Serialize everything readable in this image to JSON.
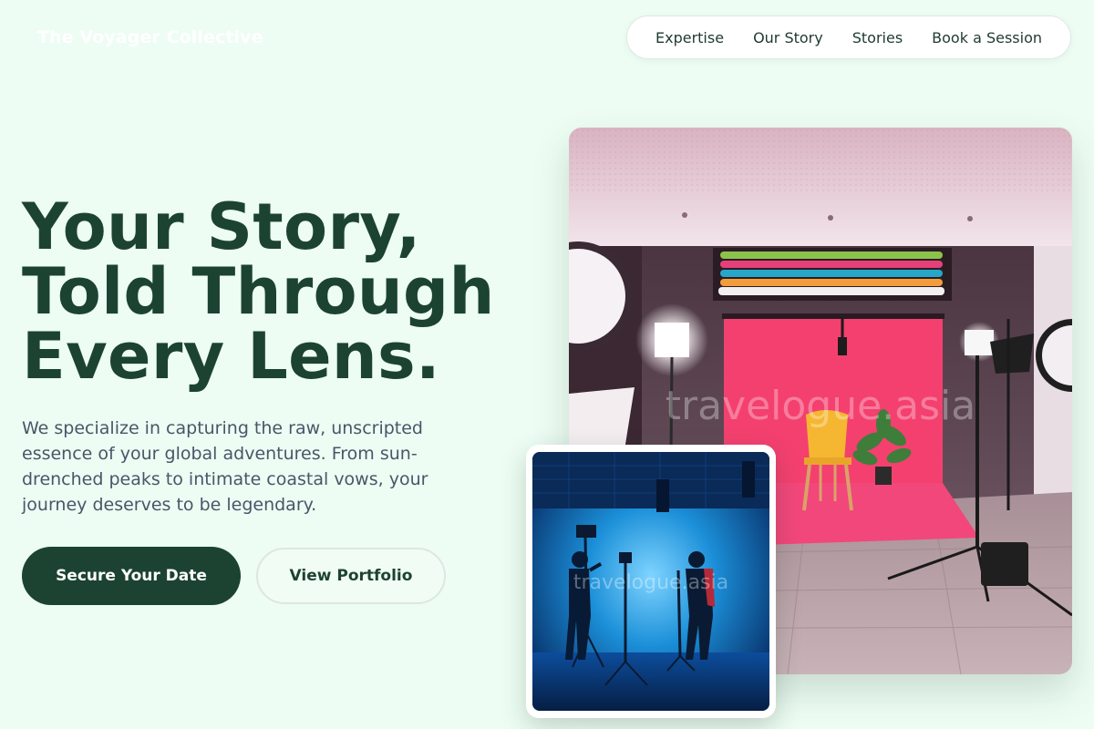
{
  "header": {
    "brand": "The Voyager Collective",
    "nav": [
      {
        "label": "Expertise"
      },
      {
        "label": "Our Story"
      },
      {
        "label": "Stories"
      },
      {
        "label": "Book a Session"
      }
    ]
  },
  "hero": {
    "title_lines": [
      "Your Story,",
      "Told Through",
      "Every Lens."
    ],
    "subtitle": "We specialize in capturing the raw, unscripted essence of your global adventures. From sun-drenched peaks to intimate coastal vows, your journey deserves to be legendary.",
    "primary_button": "Secure Your Date",
    "secondary_button": "View Portfolio"
  },
  "images": {
    "main_watermark": "travelogue.asia",
    "inset_watermark": "travelogue.asia"
  },
  "colors": {
    "page_background": "#edfdf3",
    "brand_green": "#1c4331",
    "body_text": "#495668",
    "backdrop_pink": "#f4406f"
  }
}
